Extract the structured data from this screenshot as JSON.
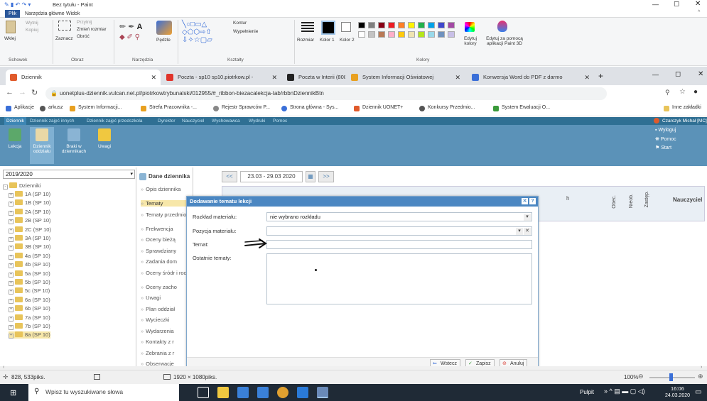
{
  "paint": {
    "title": "Bez tytułu - Paint",
    "tabs": [
      "Plik",
      "Narzędzia główne",
      "Widok"
    ],
    "clipboard": {
      "paste": "Wklej",
      "cut": "Wytnij",
      "copy": "Kopiuj"
    },
    "image": {
      "crop": "Przytnij",
      "resize": "Zmień rozmiar",
      "rotate": "Obróć",
      "select": "Zaznacz"
    },
    "brushes": "Pędzle",
    "shapes": {
      "outline": "Kontur",
      "fill": "Wypełnienie"
    },
    "size": "Rozmiar",
    "color1": "Kolor 1",
    "color2": "Kolor 2",
    "edit_colors": "Edytuj kolory",
    "paint3d": "Edytuj za pomocą aplikacji Paint 3D",
    "groups": [
      "Schowek",
      "Obraz",
      "Narzędzia",
      "Kształty",
      "Kolory"
    ],
    "palette": [
      "#000000",
      "#7f7f7f",
      "#880015",
      "#ed1c24",
      "#ff7f27",
      "#fff200",
      "#22b14c",
      "#00a2e8",
      "#3f48cc",
      "#a349a4",
      "#ffffff",
      "#c3c3c3",
      "#b97a57",
      "#ffaec9",
      "#ffc90e",
      "#efe4b0",
      "#b5e61d",
      "#99d9ea",
      "#7092be",
      "#c8bfe7"
    ]
  },
  "browser": {
    "tabs": [
      {
        "label": "Dziennik",
        "color": "#e05a2b"
      },
      {
        "label": "Poczta - sp10 sp10.piotrkow.pl -",
        "color": "#e0342b"
      },
      {
        "label": "Poczta w Interii (808)",
        "color": "#222222"
      },
      {
        "label": "System Informacji Oświatowej",
        "color": "#e8a020"
      },
      {
        "label": "Konwersja Word do PDF z darmo",
        "color": "#3a6fd8"
      }
    ],
    "url": "uonetplus-dziennik.vulcan.net.pl/piotrkowtrybunalski/012955/#_ribbon-biezacalekcja-tab/rbbnDziennikBtn",
    "bookmarks": [
      "Aplikacje",
      "arkusz",
      "System Informacji...",
      "Strefa Pracownika -...",
      "Rejestr Sprawców P...",
      "Strona główna - Sys...",
      "Dziennik UONET+",
      "Konkursy Przedmio...",
      "System Ewaluacji O..."
    ],
    "other_bookmarks": "Inne zakładki"
  },
  "app": {
    "menu": [
      "Dziennik",
      "Dziennik zajęć innych",
      "Dziennik zajęć przedszkola",
      "Dyrektor",
      "Nauczyciel",
      "Wychowawca",
      "Wydruki",
      "Pomoc"
    ],
    "user": "Czarczyk Michał [MC]",
    "toolbar": [
      "Lekcja",
      "Dziennik oddziału",
      "Braki w dziennikach",
      "Uwagi"
    ],
    "right_links": [
      "Wyloguj",
      "Pomoc",
      "Start"
    ],
    "year": "2019/2020",
    "tree_root": "Dzienniki",
    "classes": [
      "1A (SP 10)",
      "1B (SP 10)",
      "2A (SP 10)",
      "2B (SP 10)",
      "2C (SP 10)",
      "3A (SP 10)",
      "3B (SP 10)",
      "4a (SP 10)",
      "4b (SP 10)",
      "5a (SP 10)",
      "5b (SP 10)",
      "5c (SP 10)",
      "6a (SP 10)",
      "6b (SP 10)",
      "7a (SP 10)",
      "7b (SP 10)",
      "8a (SP 10)"
    ],
    "mid_header": "Dane dziennika",
    "mid_items": [
      "Opis dziennika",
      "Tematy",
      "Tematy przedmiotow",
      "Frekwencja",
      "Oceny bieżą",
      "Sprawdziany",
      "Zadania dom",
      "Oceny śródr i roczne",
      "Oceny zacho",
      "Uwagi",
      "Plan oddział",
      "Wycieczki",
      "Wydarzenia",
      "Kontakty z r",
      "Zebrania z r",
      "Obserwacje"
    ],
    "week_range": "23.03 - 29.03 2020",
    "columns": [
      "Obec.",
      "Nieob.",
      "Zastęp.",
      "Nauczyciel"
    ],
    "partial_col": "h"
  },
  "dialog": {
    "title": "Dodawanie tematu lekcji",
    "fields": [
      {
        "label": "Rozkład materiału:",
        "value": "nie wybrano rozkładu"
      },
      {
        "label": "Pozycja materiału:",
        "value": ""
      },
      {
        "label": "Temat:",
        "value": ""
      },
      {
        "label": "Ostatnie tematy:",
        "value": ""
      }
    ],
    "buttons": [
      "Wstecz",
      "Zapisz",
      "Anuluj"
    ]
  },
  "statusbar": {
    "coords": "828, 533piks.",
    "size": "1920 × 1080piks.",
    "zoom": "100%"
  },
  "taskbar": {
    "search": "Wpisz tu wyszukiwane słowa",
    "desktop": "Pulpit",
    "time": "16:06",
    "date": "24.03.2020"
  }
}
